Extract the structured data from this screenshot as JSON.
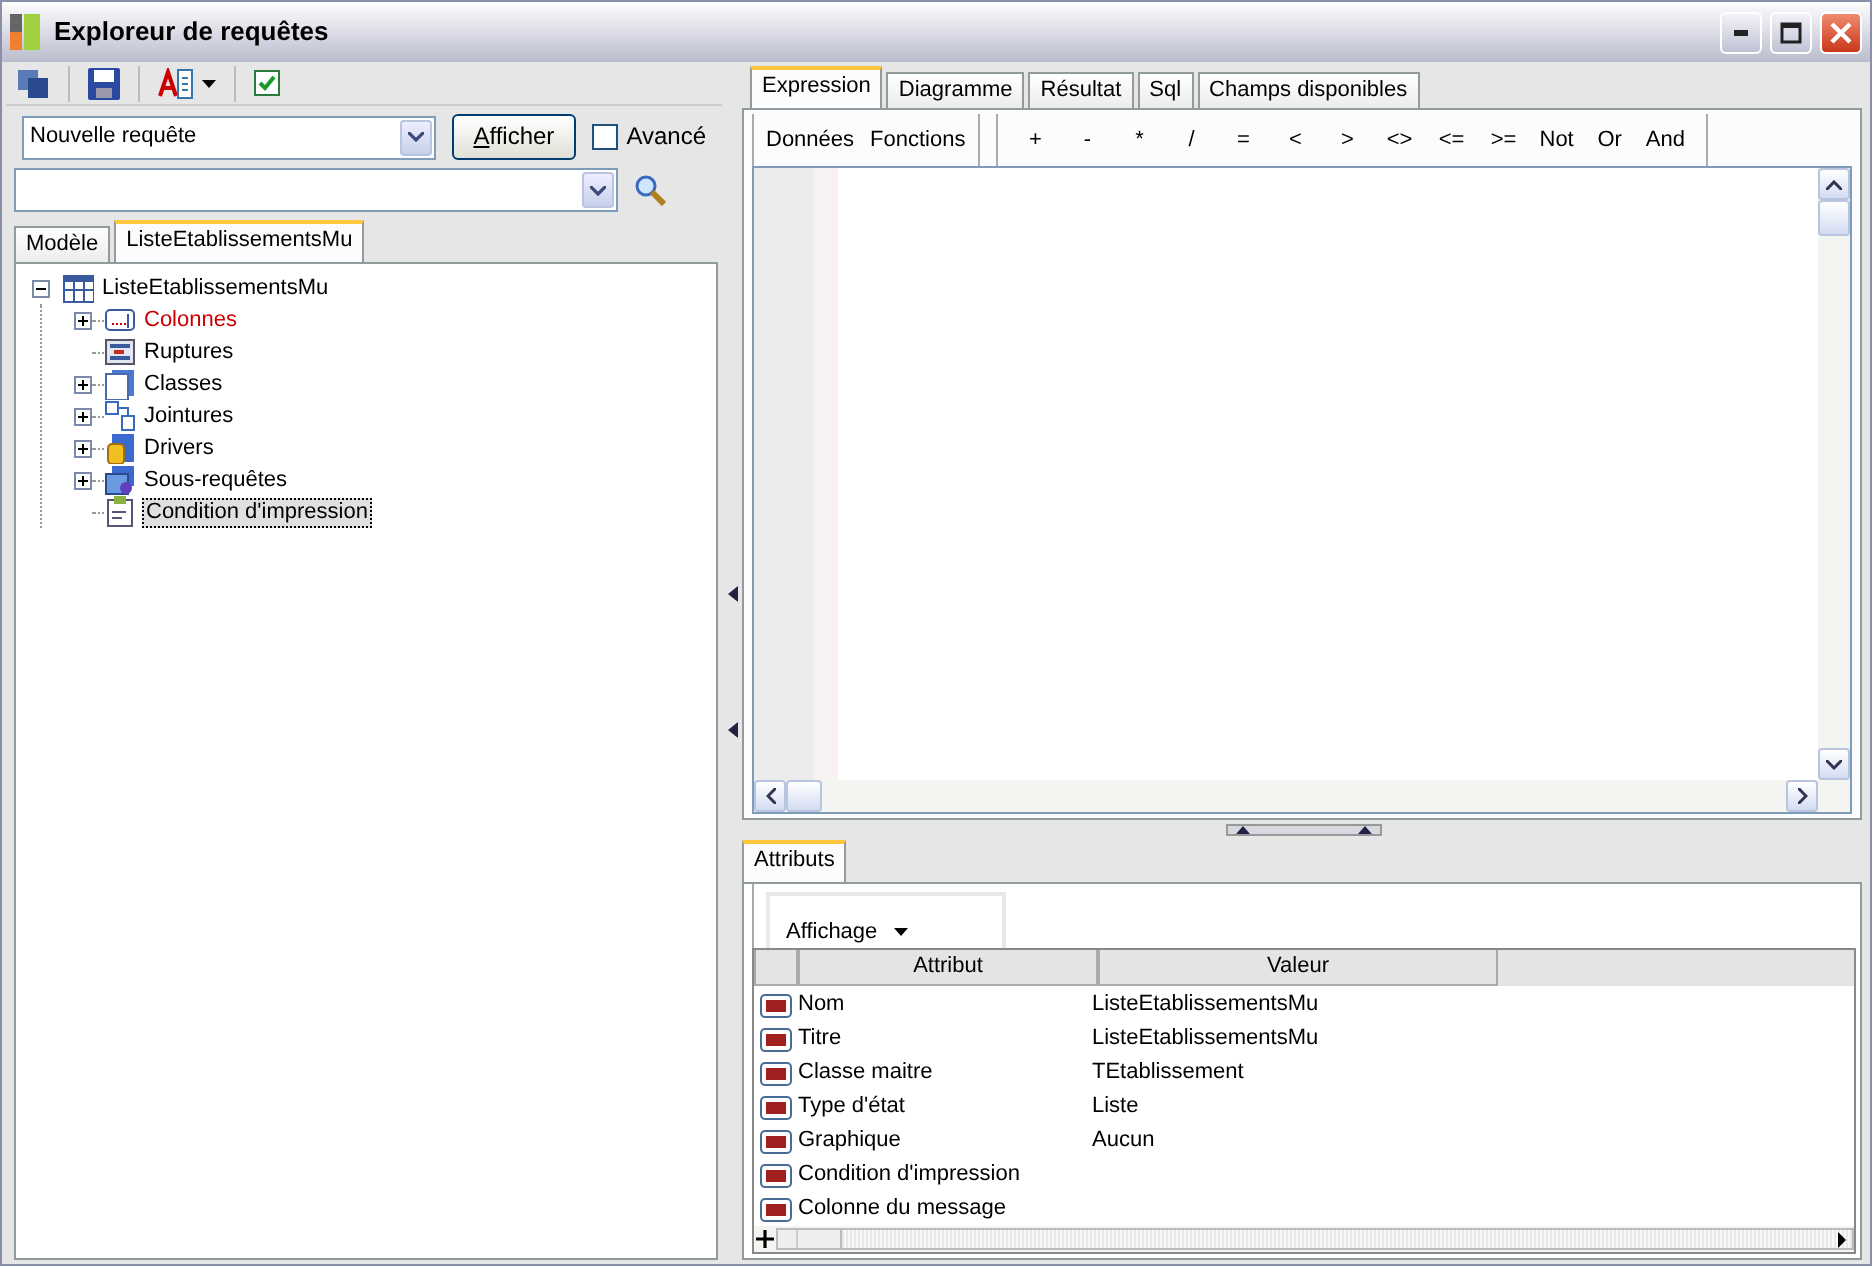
{
  "window": {
    "title": "Exploreur de requêtes"
  },
  "query": {
    "value": "Nouvelle requête",
    "button": "Afficher",
    "advanced": {
      "label": "Avancé",
      "checked": false
    }
  },
  "left_tabs": [
    {
      "label": "Modèle",
      "selected": false
    },
    {
      "label": "ListeEtablissementsMu",
      "selected": true
    }
  ],
  "tree": {
    "label": "ListeEtablissementsMu",
    "kind": "table",
    "expanded": true,
    "children": [
      {
        "label": "Colonnes",
        "kind": "columns",
        "expandable": true,
        "color": "#cc0000",
        "selected": false
      },
      {
        "label": "Ruptures",
        "kind": "breaks",
        "expandable": false,
        "color": "#000000",
        "selected": false
      },
      {
        "label": "Classes",
        "kind": "classes",
        "expandable": true,
        "color": "#000000",
        "selected": false
      },
      {
        "label": "Jointures",
        "kind": "joins",
        "expandable": true,
        "color": "#000000",
        "selected": false
      },
      {
        "label": "Drivers",
        "kind": "drivers",
        "expandable": true,
        "color": "#000000",
        "selected": false
      },
      {
        "label": "Sous-requêtes",
        "kind": "subqueries",
        "expandable": true,
        "color": "#000000",
        "selected": false
      },
      {
        "label": "Condition d'impression",
        "kind": "condition",
        "expandable": false,
        "color": "#000000",
        "selected": true
      }
    ]
  },
  "right_tabs": [
    {
      "label": "Expression",
      "selected": true
    },
    {
      "label": "Diagramme",
      "selected": false
    },
    {
      "label": "Résultat",
      "selected": false
    },
    {
      "label": "Sql",
      "selected": false
    },
    {
      "label": "Champs disponibles",
      "selected": false
    }
  ],
  "expression_toolbar": {
    "menus": [
      "Données",
      "Fonctions"
    ],
    "operators": [
      "+",
      "-",
      "*",
      "/",
      "=",
      "<",
      ">",
      "<>",
      "<=",
      ">=",
      "Not",
      "Or",
      "And"
    ]
  },
  "bottom_tabs": [
    {
      "label": "Attributs",
      "selected": true
    }
  ],
  "display_button": "Affichage",
  "grid": {
    "columns": [
      "Attribut",
      "Valeur"
    ],
    "rows": [
      {
        "attribute": "Nom",
        "value": "ListeEtablissementsMu"
      },
      {
        "attribute": "Titre",
        "value": "ListeEtablissementsMu"
      },
      {
        "attribute": "Classe maitre",
        "value": "TEtablissement"
      },
      {
        "attribute": "Type d'état",
        "value": "Liste"
      },
      {
        "attribute": "Graphique",
        "value": "Aucun"
      },
      {
        "attribute": "Condition d'impression",
        "value": ""
      },
      {
        "attribute": "Colonne du message",
        "value": ""
      }
    ]
  }
}
